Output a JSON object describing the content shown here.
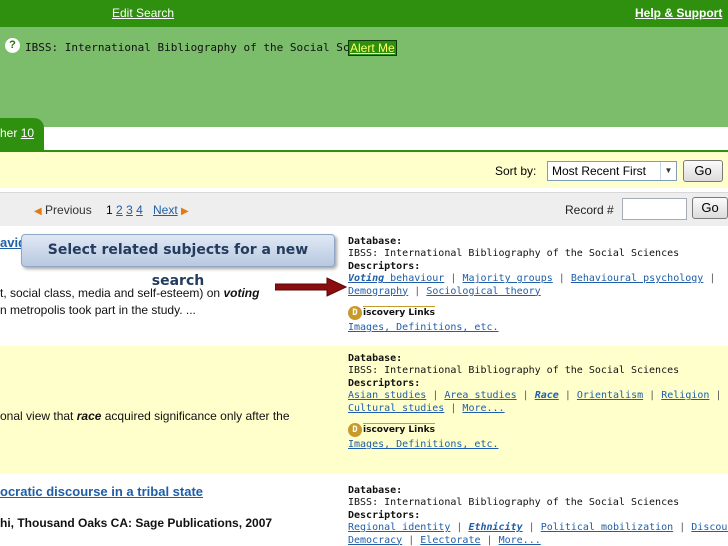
{
  "header": {
    "edit_search": "Edit Search",
    "help_support": "Help & Support"
  },
  "banner": {
    "help_glyph": "?",
    "database": "IBSS: International Bibliography of the Social Sciences",
    "alert_me": "Alert Me"
  },
  "tab": {
    "label_fragment": "her",
    "count": "10"
  },
  "sort": {
    "label": "Sort by:",
    "selected": "Most Recent First",
    "go": "Go"
  },
  "pagination": {
    "previous": "Previous",
    "pages": [
      "1",
      "2",
      "3",
      "4"
    ],
    "next": "Next",
    "record_label": "Record #",
    "record_value": "",
    "go": "Go"
  },
  "callout": "Select related subjects for a new search",
  "results": [
    {
      "title_fragment": "avid",
      "snippet1_before": "t, social class, media and self-esteem) on ",
      "snippet1_em": "voting",
      "snippet2": "n metropolis took part in the study. ...",
      "database_label": "Database:",
      "database": "IBSS: International Bibliography of the Social Sciences",
      "descriptors_label": "Descriptors:",
      "descriptors": [
        {
          "term_em": "Voting",
          "term": " behaviour"
        },
        {
          "term_em": "",
          "term": "Majority groups"
        },
        {
          "term_em": "",
          "term": "Behavioural psychology"
        },
        {
          "term_em": "",
          "term": "Demography"
        },
        {
          "term_em": "",
          "term": "Sociological theory"
        }
      ],
      "discovery_d": "D",
      "discovery_label": "iscovery Links",
      "discovery_link": "Images, Definitions, etc."
    },
    {
      "snippet1_before": "onal view that ",
      "snippet1_em": "race",
      "snippet1_after": " acquired significance only after the",
      "database_label": "Database:",
      "database": "IBSS: International Bibliography of the Social Sciences",
      "descriptors_label": "Descriptors:",
      "descriptors": [
        {
          "term_em": "",
          "term": "Asian studies"
        },
        {
          "term_em": "",
          "term": "Area studies"
        },
        {
          "term_em": "Race",
          "term": ""
        },
        {
          "term_em": "",
          "term": "Orientalism"
        },
        {
          "term_em": "",
          "term": "Religion"
        },
        {
          "term_em": "",
          "term": "Cultural studies"
        },
        {
          "term_em": "",
          "term": "More..."
        }
      ],
      "discovery_d": "D",
      "discovery_label": "iscovery Links",
      "discovery_link": "Images, Definitions, etc."
    },
    {
      "title_fragment": "ocratic discourse in a tribal state",
      "publisher": "hi, Thousand Oaks CA: Sage Publications, 2007",
      "database_label": "Database:",
      "database": "IBSS: International Bibliography of the Social Sciences",
      "descriptors_label": "Descriptors:",
      "descriptors": [
        {
          "term_em": "",
          "term": "Regional identity"
        },
        {
          "term_em": "Ethnicity",
          "term": ""
        },
        {
          "term_em": "",
          "term": "Political mobilization"
        },
        {
          "term_em": "",
          "term": "Discourse"
        },
        {
          "term_em": "",
          "term": "Democracy"
        },
        {
          "term_em": "",
          "term": "Electorate"
        },
        {
          "term_em": "",
          "term": "More..."
        }
      ]
    }
  ],
  "colors": {
    "header_green": "#2f8f0e",
    "band_green": "#7bbd6b",
    "row_yellow": "#ffffcc",
    "link_blue": "#1f5ea8",
    "arrow_red": "#8b0d0d"
  }
}
